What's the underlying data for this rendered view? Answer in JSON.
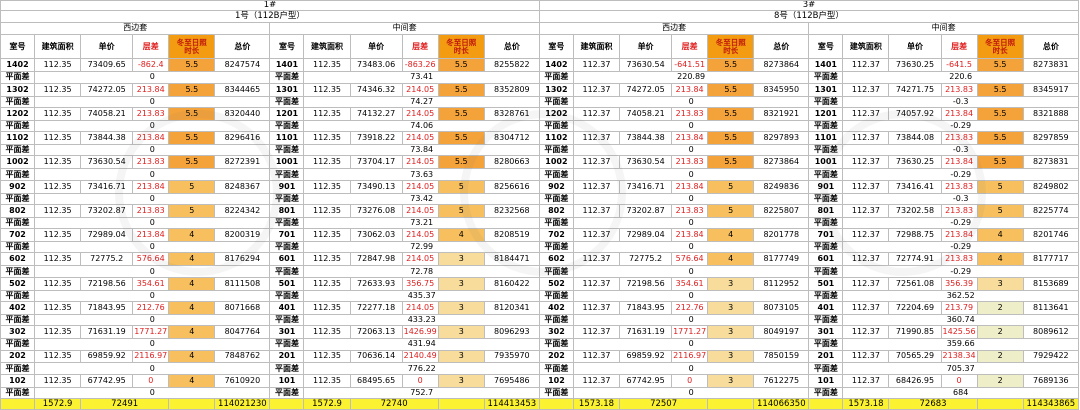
{
  "buildings": [
    {
      "name": "1#",
      "subtitle": "1号（112B户型）",
      "groups": [
        {
          "label": "西边套",
          "rows": [
            {
              "room": "1402",
              "area": "112.35",
              "price": "73409.65",
              "diff": "-862.4",
              "sun": "5.5",
              "sun_level": "dark",
              "total": "8247574",
              "flat": "0"
            },
            {
              "room": "1302",
              "area": "112.35",
              "price": "74272.05",
              "diff": "213.84",
              "sun": "5.5",
              "sun_level": "dark",
              "total": "8344465",
              "flat": "0"
            },
            {
              "room": "1202",
              "area": "112.35",
              "price": "74058.21",
              "diff": "213.83",
              "sun": "5.5",
              "sun_level": "dark",
              "total": "8320440",
              "flat": "0"
            },
            {
              "room": "1102",
              "area": "112.35",
              "price": "73844.38",
              "diff": "213.84",
              "sun": "5.5",
              "sun_level": "dark",
              "total": "8296416",
              "flat": "0"
            },
            {
              "room": "1002",
              "area": "112.35",
              "price": "73630.54",
              "diff": "213.83",
              "sun": "5.5",
              "sun_level": "dark",
              "total": "8272391",
              "flat": "0"
            },
            {
              "room": "902",
              "area": "112.35",
              "price": "73416.71",
              "diff": "213.84",
              "sun": "5",
              "sun_level": "mid",
              "total": "8248367",
              "flat": "0"
            },
            {
              "room": "802",
              "area": "112.35",
              "price": "73202.87",
              "diff": "213.83",
              "sun": "5",
              "sun_level": "mid",
              "total": "8224342",
              "flat": "0"
            },
            {
              "room": "702",
              "area": "112.35",
              "price": "72989.04",
              "diff": "213.84",
              "sun": "4",
              "sun_level": "mid",
              "total": "8200319",
              "flat": "0"
            },
            {
              "room": "602",
              "area": "112.35",
              "price": "72775.2",
              "diff": "576.64",
              "sun": "4",
              "sun_level": "mid",
              "total": "8176294",
              "flat": "0"
            },
            {
              "room": "502",
              "area": "112.35",
              "price": "72198.56",
              "diff": "354.61",
              "sun": "4",
              "sun_level": "mid",
              "total": "8111508",
              "flat": "0"
            },
            {
              "room": "402",
              "area": "112.35",
              "price": "71843.95",
              "diff": "212.76",
              "sun": "4",
              "sun_level": "mid",
              "total": "8071668",
              "flat": "0"
            },
            {
              "room": "302",
              "area": "112.35",
              "price": "71631.19",
              "diff": "1771.27",
              "sun": "4",
              "sun_level": "mid",
              "total": "8047764",
              "flat": "0"
            },
            {
              "room": "202",
              "area": "112.35",
              "price": "69859.92",
              "diff": "2116.97",
              "sun": "4",
              "sun_level": "mid",
              "total": "7848762",
              "flat": "0"
            },
            {
              "room": "102",
              "area": "112.35",
              "price": "67742.95",
              "diff": "0",
              "sun": "4",
              "sun_level": "mid",
              "total": "7610920",
              "flat": "0"
            }
          ],
          "total": {
            "area": "1572.9",
            "price": "72491",
            "total": "114021230"
          }
        },
        {
          "label": "中间套",
          "rows": [
            {
              "room": "1401",
              "area": "112.35",
              "price": "73483.06",
              "diff": "-863.26",
              "sun": "5.5",
              "sun_level": "dark",
              "total": "8255822",
              "flat": "73.41"
            },
            {
              "room": "1301",
              "area": "112.35",
              "price": "74346.32",
              "diff": "214.05",
              "sun": "5.5",
              "sun_level": "dark",
              "total": "8352809",
              "flat": "74.27"
            },
            {
              "room": "1201",
              "area": "112.35",
              "price": "74132.27",
              "diff": "214.05",
              "sun": "5.5",
              "sun_level": "dark",
              "total": "8328761",
              "flat": "74.06"
            },
            {
              "room": "1101",
              "area": "112.35",
              "price": "73918.22",
              "diff": "214.05",
              "sun": "5.5",
              "sun_level": "dark",
              "total": "8304712",
              "flat": "73.84"
            },
            {
              "room": "1001",
              "area": "112.35",
              "price": "73704.17",
              "diff": "214.05",
              "sun": "5.5",
              "sun_level": "dark",
              "total": "8280663",
              "flat": "73.63"
            },
            {
              "room": "901",
              "area": "112.35",
              "price": "73490.13",
              "diff": "214.05",
              "sun": "5",
              "sun_level": "mid",
              "total": "8256616",
              "flat": "73.42"
            },
            {
              "room": "801",
              "area": "112.35",
              "price": "73276.08",
              "diff": "214.05",
              "sun": "5",
              "sun_level": "mid",
              "total": "8232568",
              "flat": "73.21"
            },
            {
              "room": "701",
              "area": "112.35",
              "price": "73062.03",
              "diff": "214.05",
              "sun": "4",
              "sun_level": "mid",
              "total": "8208519",
              "flat": "72.99"
            },
            {
              "room": "601",
              "area": "112.35",
              "price": "72847.98",
              "diff": "214.05",
              "sun": "3",
              "sun_level": "light",
              "total": "8184471",
              "flat": "72.78"
            },
            {
              "room": "501",
              "area": "112.35",
              "price": "72633.93",
              "diff": "356.75",
              "sun": "3",
              "sun_level": "light",
              "total": "8160422",
              "flat": "435.37"
            },
            {
              "room": "401",
              "area": "112.35",
              "price": "72277.18",
              "diff": "214.05",
              "sun": "3",
              "sun_level": "light",
              "total": "8120341",
              "flat": "433.23"
            },
            {
              "room": "301",
              "area": "112.35",
              "price": "72063.13",
              "diff": "1426.99",
              "sun": "3",
              "sun_level": "light",
              "total": "8096293",
              "flat": "431.94"
            },
            {
              "room": "201",
              "area": "112.35",
              "price": "70636.14",
              "diff": "2140.49",
              "sun": "3",
              "sun_level": "light",
              "total": "7935970",
              "flat": "776.22"
            },
            {
              "room": "101",
              "area": "112.35",
              "price": "68495.65",
              "diff": "0",
              "sun": "3",
              "sun_level": "light",
              "total": "7695486",
              "flat": "752.7"
            }
          ],
          "total": {
            "area": "1572.9",
            "price": "72740",
            "total": "114413453"
          }
        }
      ]
    },
    {
      "name": "3#",
      "subtitle": "8号（112B户型）",
      "groups": [
        {
          "label": "西边套",
          "rows": [
            {
              "room": "1402",
              "area": "112.37",
              "price": "73630.54",
              "diff": "-641.51",
              "sun": "5.5",
              "sun_level": "dark",
              "total": "8273864",
              "flat": "220.89"
            },
            {
              "room": "1302",
              "area": "112.37",
              "price": "74272.05",
              "diff": "213.84",
              "sun": "5.5",
              "sun_level": "dark",
              "total": "8345950",
              "flat": "0"
            },
            {
              "room": "1202",
              "area": "112.37",
              "price": "74058.21",
              "diff": "213.83",
              "sun": "5.5",
              "sun_level": "dark",
              "total": "8321921",
              "flat": "0"
            },
            {
              "room": "1102",
              "area": "112.37",
              "price": "73844.38",
              "diff": "213.84",
              "sun": "5.5",
              "sun_level": "dark",
              "total": "8297893",
              "flat": "0"
            },
            {
              "room": "1002",
              "area": "112.37",
              "price": "73630.54",
              "diff": "213.83",
              "sun": "5.5",
              "sun_level": "dark",
              "total": "8273864",
              "flat": "0"
            },
            {
              "room": "902",
              "area": "112.37",
              "price": "73416.71",
              "diff": "213.84",
              "sun": "5",
              "sun_level": "mid",
              "total": "8249836",
              "flat": "0"
            },
            {
              "room": "802",
              "area": "112.37",
              "price": "73202.87",
              "diff": "213.83",
              "sun": "5",
              "sun_level": "mid",
              "total": "8225807",
              "flat": "0"
            },
            {
              "room": "702",
              "area": "112.37",
              "price": "72989.04",
              "diff": "213.84",
              "sun": "4",
              "sun_level": "mid",
              "total": "8201778",
              "flat": "0"
            },
            {
              "room": "602",
              "area": "112.37",
              "price": "72775.2",
              "diff": "576.64",
              "sun": "4",
              "sun_level": "mid",
              "total": "8177749",
              "flat": "0"
            },
            {
              "room": "502",
              "area": "112.37",
              "price": "72198.56",
              "diff": "354.61",
              "sun": "3",
              "sun_level": "light",
              "total": "8112952",
              "flat": "0"
            },
            {
              "room": "402",
              "area": "112.37",
              "price": "71843.95",
              "diff": "212.76",
              "sun": "3",
              "sun_level": "light",
              "total": "8073105",
              "flat": "0"
            },
            {
              "room": "302",
              "area": "112.37",
              "price": "71631.19",
              "diff": "1771.27",
              "sun": "3",
              "sun_level": "light",
              "total": "8049197",
              "flat": "0"
            },
            {
              "room": "202",
              "area": "112.37",
              "price": "69859.92",
              "diff": "2116.97",
              "sun": "3",
              "sun_level": "light",
              "total": "7850159",
              "flat": "0"
            },
            {
              "room": "102",
              "area": "112.37",
              "price": "67742.95",
              "diff": "0",
              "sun": "3",
              "sun_level": "light",
              "total": "7612275",
              "flat": "0"
            }
          ],
          "total": {
            "area": "1573.18",
            "price": "72507",
            "total": "114066350"
          }
        },
        {
          "label": "中间套",
          "rows": [
            {
              "room": "1401",
              "area": "112.37",
              "price": "73630.25",
              "diff": "-641.5",
              "sun": "5.5",
              "sun_level": "dark",
              "total": "8273831",
              "flat": "220.6"
            },
            {
              "room": "1301",
              "area": "112.37",
              "price": "74271.75",
              "diff": "213.83",
              "sun": "5.5",
              "sun_level": "dark",
              "total": "8345917",
              "flat": "-0.3"
            },
            {
              "room": "1201",
              "area": "112.37",
              "price": "74057.92",
              "diff": "213.84",
              "sun": "5.5",
              "sun_level": "dark",
              "total": "8321888",
              "flat": "-0.29"
            },
            {
              "room": "1101",
              "area": "112.37",
              "price": "73844.08",
              "diff": "213.83",
              "sun": "5.5",
              "sun_level": "dark",
              "total": "8297859",
              "flat": "-0.3"
            },
            {
              "room": "1001",
              "area": "112.37",
              "price": "73630.25",
              "diff": "213.84",
              "sun": "5.5",
              "sun_level": "dark",
              "total": "8273831",
              "flat": "-0.29"
            },
            {
              "room": "901",
              "area": "112.37",
              "price": "73416.41",
              "diff": "213.83",
              "sun": "5",
              "sun_level": "mid",
              "total": "8249802",
              "flat": "-0.3"
            },
            {
              "room": "801",
              "area": "112.37",
              "price": "73202.58",
              "diff": "213.83",
              "sun": "5",
              "sun_level": "mid",
              "total": "8225774",
              "flat": "-0.29"
            },
            {
              "room": "701",
              "area": "112.37",
              "price": "72988.75",
              "diff": "213.84",
              "sun": "4",
              "sun_level": "mid",
              "total": "8201746",
              "flat": "-0.29"
            },
            {
              "room": "601",
              "area": "112.37",
              "price": "72774.91",
              "diff": "213.83",
              "sun": "4",
              "sun_level": "mid",
              "total": "8177717",
              "flat": "-0.29"
            },
            {
              "room": "501",
              "area": "112.37",
              "price": "72561.08",
              "diff": "356.39",
              "sun": "3",
              "sun_level": "light",
              "total": "8153689",
              "flat": "362.52"
            },
            {
              "room": "401",
              "area": "112.37",
              "price": "72204.69",
              "diff": "213.79",
              "sun": "2",
              "sun_level": "pale",
              "total": "8113641",
              "flat": "360.74"
            },
            {
              "room": "301",
              "area": "112.37",
              "price": "71990.85",
              "diff": "1425.56",
              "sun": "2",
              "sun_level": "pale",
              "total": "8089612",
              "flat": "359.66"
            },
            {
              "room": "201",
              "area": "112.37",
              "price": "70565.29",
              "diff": "2138.34",
              "sun": "2",
              "sun_level": "pale",
              "total": "7929422",
              "flat": "705.37"
            },
            {
              "room": "101",
              "area": "112.37",
              "price": "68426.95",
              "diff": "0",
              "sun": "2",
              "sun_level": "pale",
              "total": "7689136",
              "flat": "684"
            }
          ],
          "total": {
            "area": "1573.18",
            "price": "72683",
            "total": "114343865"
          }
        }
      ]
    }
  ],
  "headers": {
    "room": "室号",
    "area": "建筑面积",
    "price": "单价",
    "diff": "层差",
    "sun_line1": "冬至日照",
    "sun_line2": "时长",
    "total": "总价"
  },
  "flat_label": "平面差",
  "colors": {
    "sun_dark": "#f4a23a",
    "sun_mid": "#f7bf5e",
    "sun_light": "#f7dc9b",
    "sun_pale": "#eeeec8",
    "header_orange": "#f39c12",
    "red_text": "#e02020",
    "total_yellow": "#fbf232"
  }
}
